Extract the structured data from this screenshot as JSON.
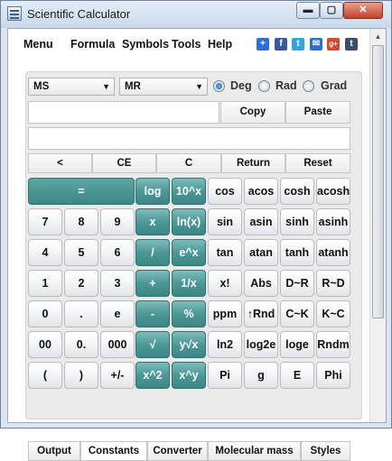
{
  "window": {
    "title": "Scientific Calculator",
    "min_glyph": "▬",
    "max_glyph": "▢",
    "close_glyph": "✕"
  },
  "menu": [
    "Menu",
    "Formula",
    "Symbols",
    "Tools",
    "Help"
  ],
  "social": [
    {
      "name": "plus-share-icon",
      "glyph": "+",
      "color": "#2c6ed2"
    },
    {
      "name": "facebook-icon",
      "glyph": "f",
      "color": "#3b5998"
    },
    {
      "name": "twitter-icon",
      "glyph": "t",
      "color": "#2aa9e0"
    },
    {
      "name": "email-icon",
      "glyph": "✉",
      "color": "#2a6fd6"
    },
    {
      "name": "google-plus-icon",
      "glyph": "g+",
      "color": "#d6492f"
    },
    {
      "name": "tumblr-icon",
      "glyph": "t",
      "color": "#3a4f66"
    }
  ],
  "memory": {
    "ms": "MS",
    "mr": "MR"
  },
  "angle_modes": [
    "Deg",
    "Rad",
    "Grad"
  ],
  "angle_selected": "Deg",
  "actions": {
    "copy": "Copy",
    "paste": "Paste"
  },
  "edit_row": [
    "<",
    "CE",
    "C",
    "Return",
    "Reset"
  ],
  "keys": [
    [
      "=",
      "",
      "log",
      "10^x",
      "cos",
      "acos",
      "cosh",
      "acosh"
    ],
    [
      "7",
      "8",
      "9",
      "x",
      "ln(x)",
      "sin",
      "asin",
      "sinh",
      "asinh"
    ],
    [
      "4",
      "5",
      "6",
      "/",
      "e^x",
      "tan",
      "atan",
      "tanh",
      "atanh"
    ],
    [
      "1",
      "2",
      "3",
      "+",
      "1/x",
      "x!",
      "Abs",
      "D~R",
      "R~D"
    ],
    [
      "0",
      ".",
      "e",
      "-",
      "%",
      "ppm",
      "↑Rnd",
      "C~K",
      "K~C"
    ],
    [
      "00",
      "0.",
      "000",
      "√",
      "y√x",
      "ln2",
      "log2e",
      "loge",
      "Rndm"
    ],
    [
      "(",
      ")",
      "+/-",
      "x^2",
      "x^y",
      "Pi",
      "g",
      "E",
      "Phi"
    ]
  ],
  "tabs": [
    "Output",
    "Constants",
    "Converter",
    "Molecular mass",
    "Styles"
  ],
  "active_tab": "Constants"
}
